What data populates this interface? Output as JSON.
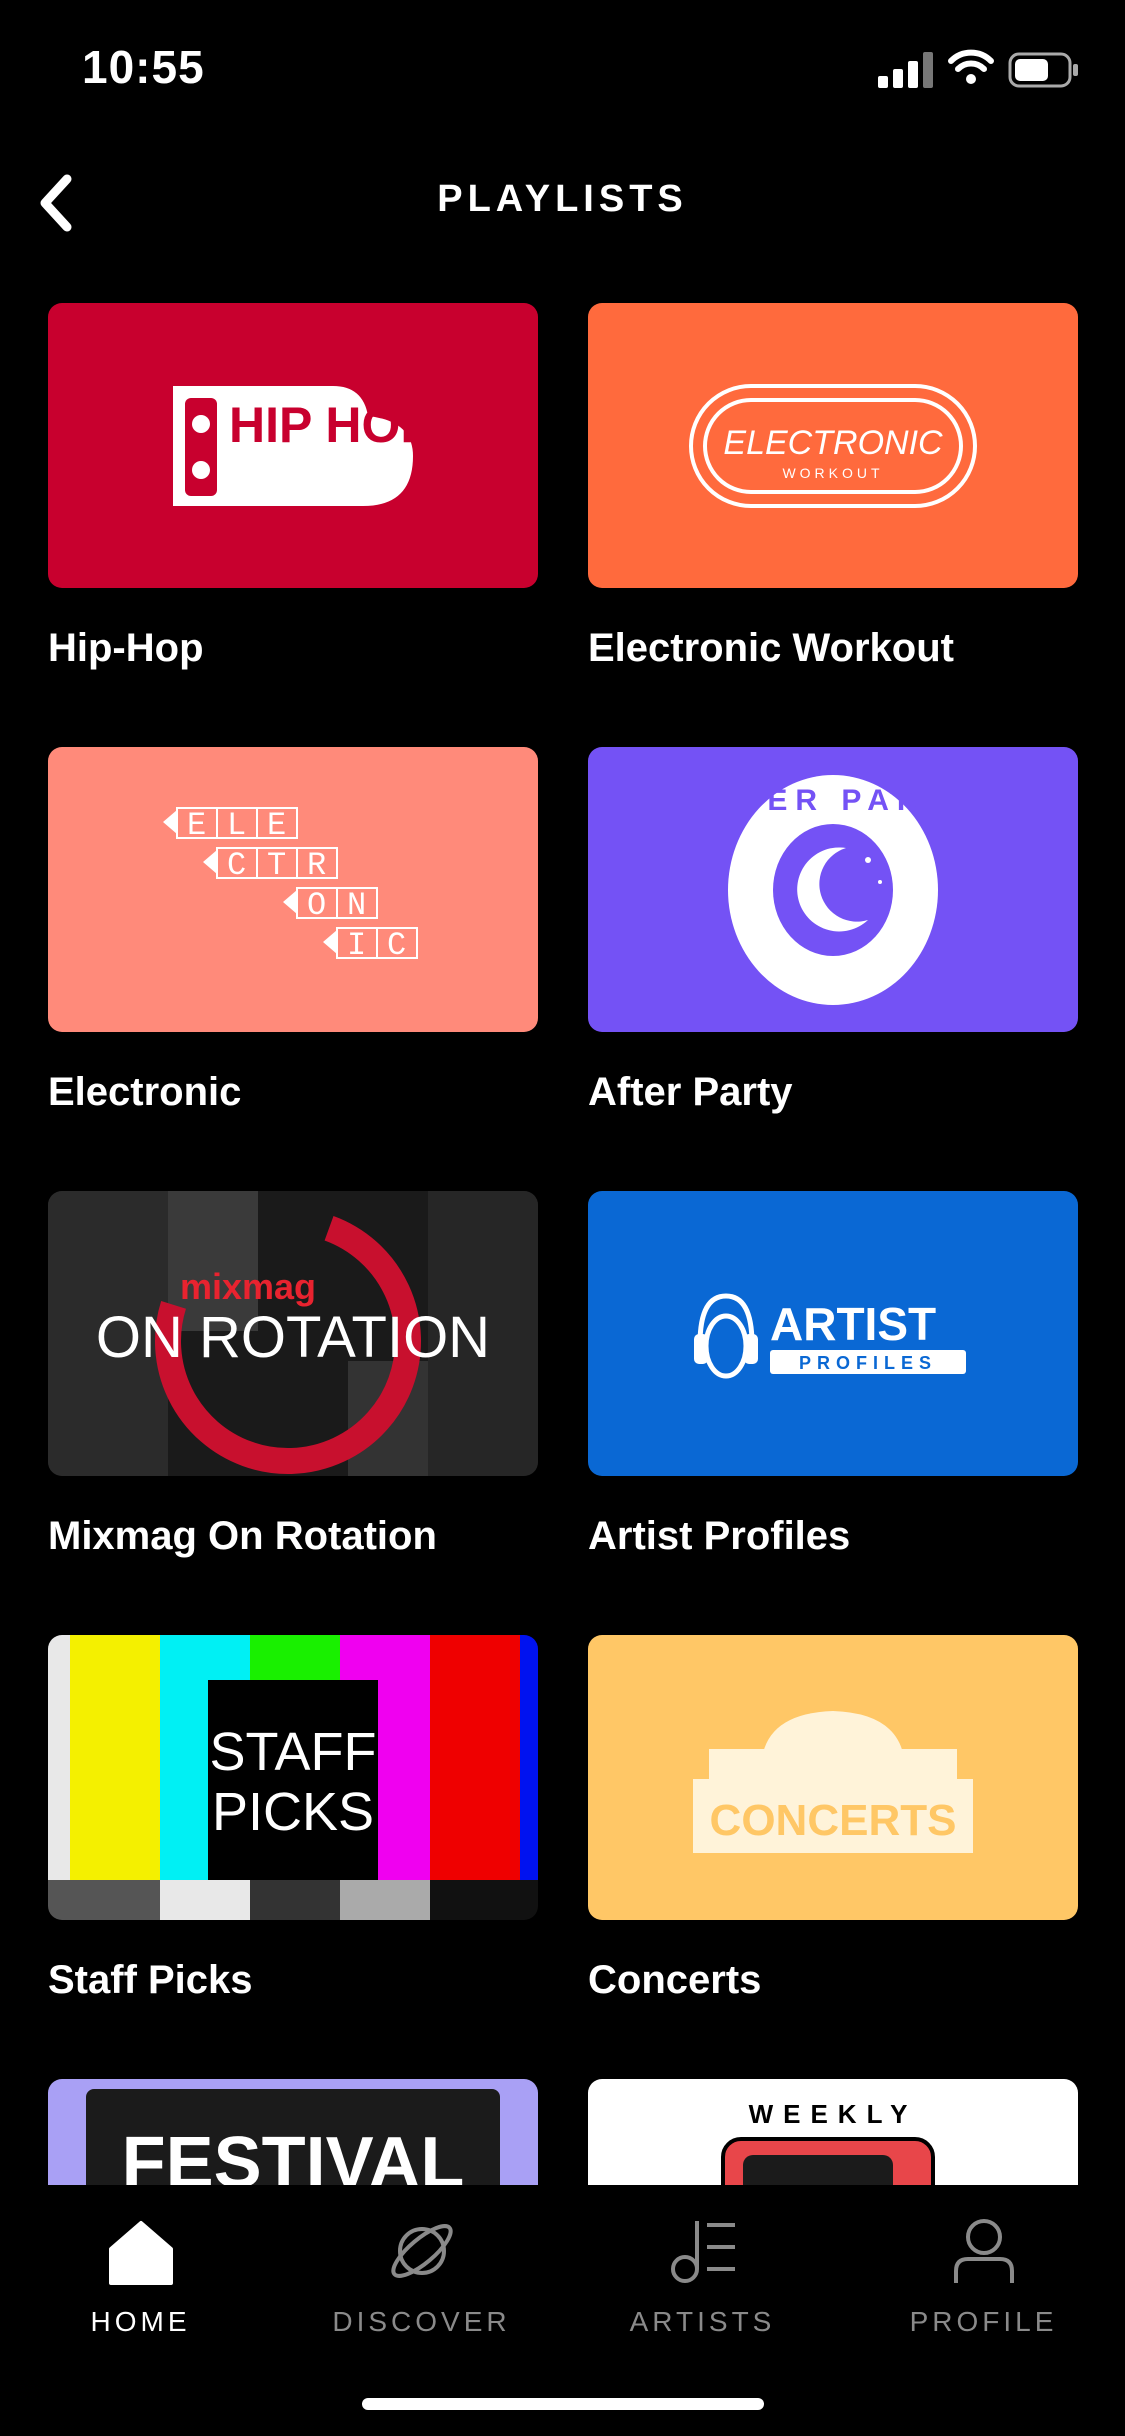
{
  "status": {
    "time": "10:55"
  },
  "header": {
    "title": "PLAYLISTS"
  },
  "playlists": [
    {
      "label": "Hip-Hop",
      "logo": "HIP HOP",
      "color": "#C8002E"
    },
    {
      "label": "Electronic Workout",
      "logo": "ELECTRONIC",
      "logo_sub": "WORKOUT",
      "color": "#FF6A3D"
    },
    {
      "label": "Electronic",
      "logo_letters": [
        "E",
        "L",
        "E",
        "C",
        "T",
        "R",
        "O",
        "N",
        "I",
        "C"
      ],
      "color": "#FF8A7A"
    },
    {
      "label": "After Party",
      "logo": "AFTER PARTY",
      "color": "#7452F5"
    },
    {
      "label": "Mixmag On Rotation",
      "logo_brand": "mixmag",
      "logo": "ON ROTATION",
      "color": "#1a1a1a"
    },
    {
      "label": "Artist Profiles",
      "logo": "ARTIST",
      "logo_sub": "PROFILES",
      "color": "#0A68D4"
    },
    {
      "label": "Staff Picks",
      "logo": "STAFF",
      "logo_sub": "PICKS",
      "color": "#000000"
    },
    {
      "label": "Concerts",
      "logo": "CONCERTS",
      "color": "#FFC766"
    },
    {
      "label": "",
      "logo": "FESTIVAL",
      "color": "#A9A0F5"
    },
    {
      "label": "",
      "logo": "WEEKLY",
      "color": "#FFFFFF"
    }
  ],
  "nav": {
    "items": [
      {
        "label": "HOME",
        "icon": "home-icon",
        "active": true
      },
      {
        "label": "DISCOVER",
        "icon": "planet-icon",
        "active": false
      },
      {
        "label": "ARTISTS",
        "icon": "music-note-list-icon",
        "active": false
      },
      {
        "label": "PROFILE",
        "icon": "person-icon",
        "active": false
      }
    ]
  }
}
